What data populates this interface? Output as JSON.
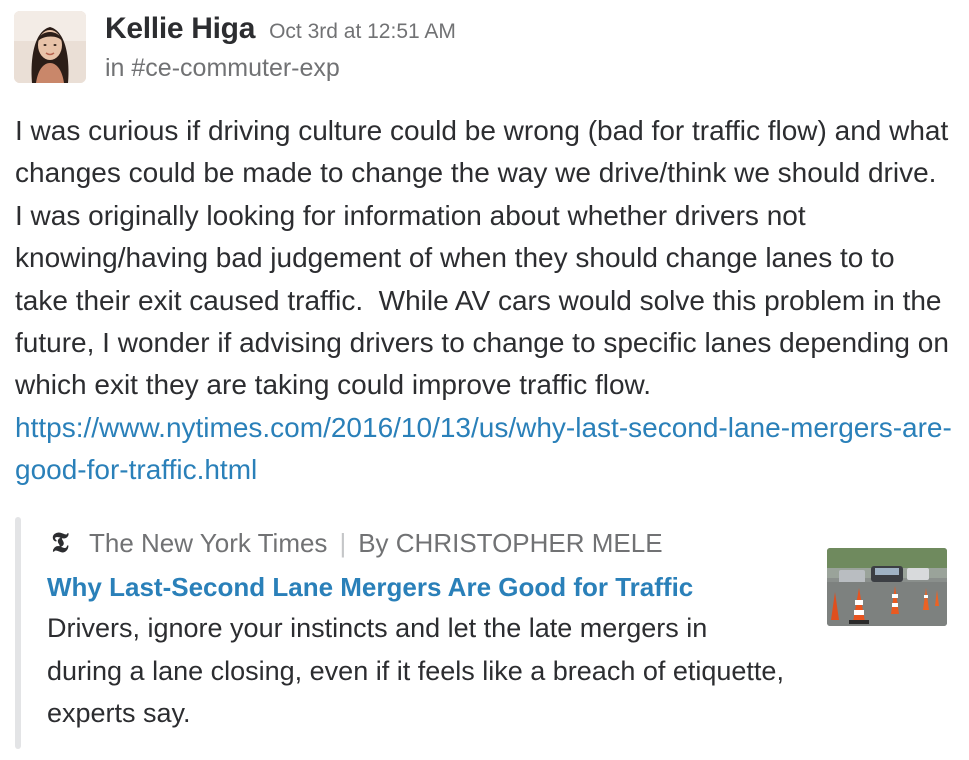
{
  "message": {
    "author": "Kellie Higa",
    "timestamp": "Oct 3rd at 12:51 AM",
    "channel_prefix": "in ",
    "channel": "#ce-commuter-exp",
    "body": "I was curious if driving culture could be wrong (bad for traffic flow) and what changes could be made to change the way we drive/think we should drive.  I was originally looking for information about whether drivers not knowing/having bad judgement of when they should change lanes to to take their exit caused traffic.  While AV cars would solve this problem in the future, I wonder if advising drivers to change to specific lanes depending on which exit they are taking could improve traffic flow.  ",
    "link": "https://www.nytimes.com/2016/10/13/us/why-last-second-lane-mergers-are-good-for-traffic.html"
  },
  "attachment": {
    "service_icon": "nyt-logo-icon",
    "service_icon_glyph": "𝕿",
    "service_name": "The New York Times",
    "separator": "|",
    "byline": "By CHRISTOPHER MELE",
    "title": "Why Last-Second Lane Mergers Are Good for Traffic",
    "description": "Drivers, ignore your instincts and let the late mergers in during a lane closing, even if it feels like a breach of etiquette, experts say.",
    "thumbnail": "traffic-cones-thumbnail"
  },
  "colors": {
    "link": "#2a80b9",
    "text": "#2c2d30",
    "muted": "#717274",
    "attachment_bar": "#e3e4e6"
  }
}
